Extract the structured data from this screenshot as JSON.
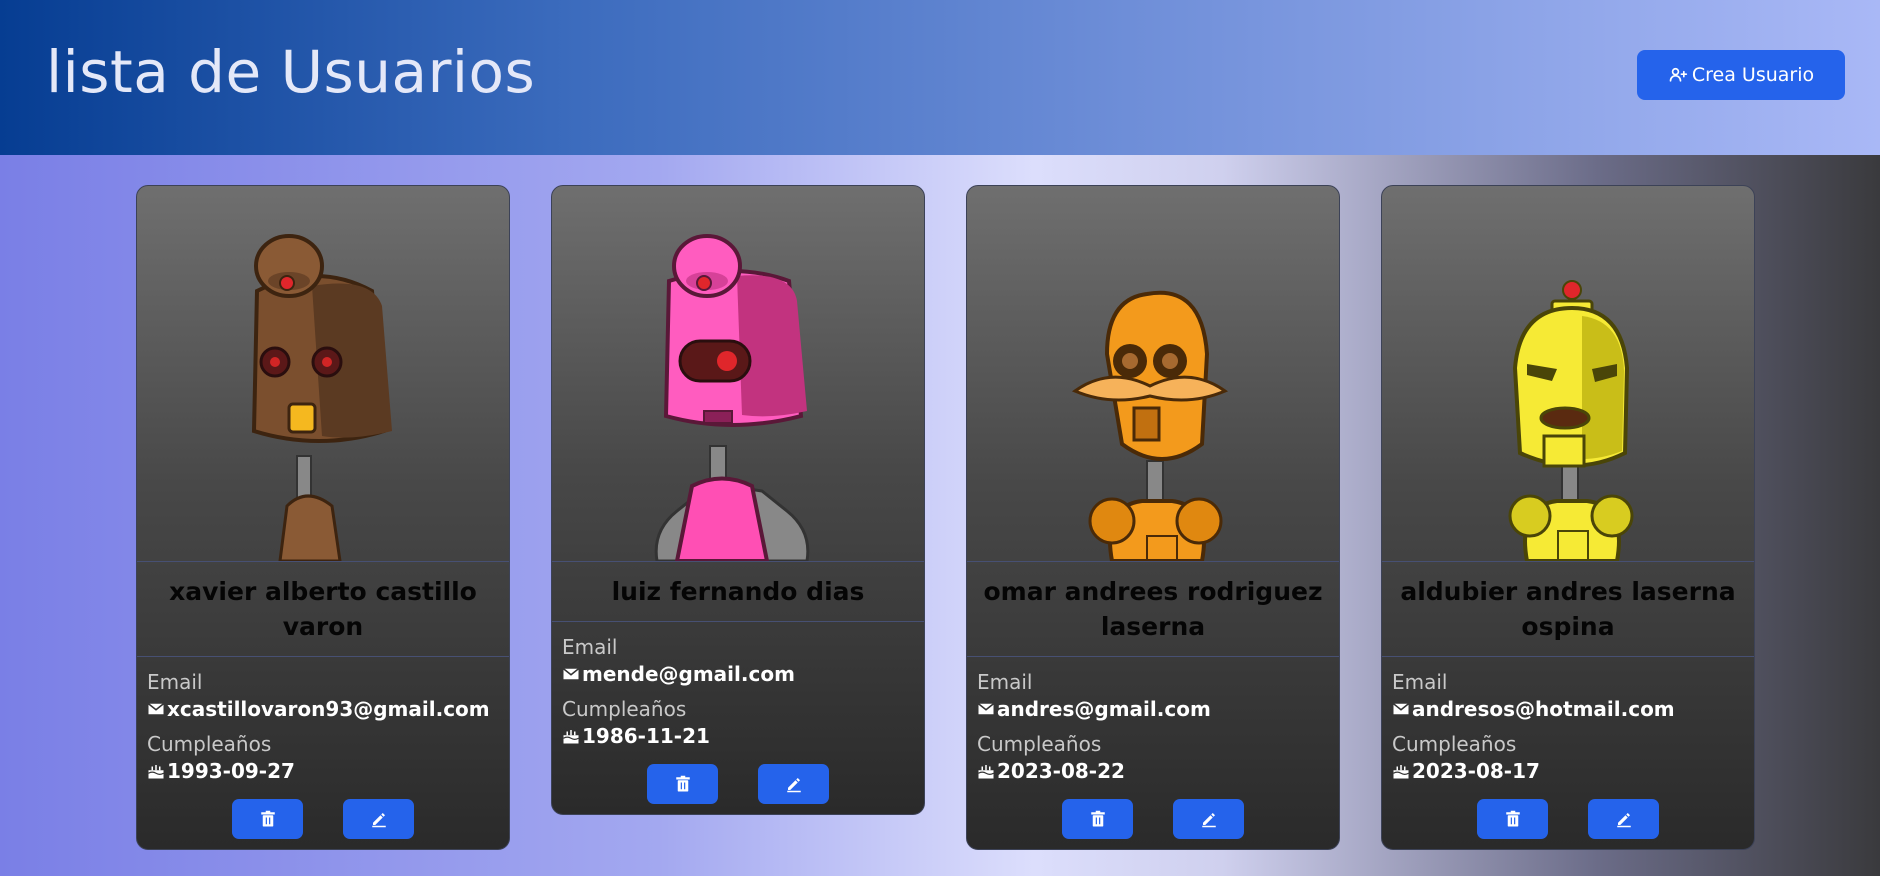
{
  "header": {
    "title": "lista de Usuarios",
    "create_button_label": "Crea Usuario",
    "create_icon": "user-plus-icon"
  },
  "labels": {
    "email": "Email",
    "birthday": "Cumpleaños"
  },
  "icons": {
    "email": "envelope-icon",
    "birthday": "cake-icon",
    "delete": "trash-icon",
    "edit": "pencil-icon"
  },
  "colors": {
    "accent": "#2563eb",
    "header_start": "#063d92",
    "header_end": "#a9b8f6"
  },
  "users": [
    {
      "name": "xavier alberto castillo varon",
      "email": "xcastillovaron93@gmail.com",
      "birthday": "1993-09-27",
      "avatar": "brown robot"
    },
    {
      "name": "luiz fernando dias",
      "email": "mende@gmail.com",
      "birthday": "1986-11-21",
      "avatar": "pink robot"
    },
    {
      "name": "omar andrees rodriguez laserna",
      "email": "andres@gmail.com",
      "birthday": "2023-08-22",
      "avatar": "orange robot"
    },
    {
      "name": "aldubier andres laserna ospina",
      "email": "andresos@hotmail.com",
      "birthday": "2023-08-17",
      "avatar": "yellow robot"
    }
  ]
}
